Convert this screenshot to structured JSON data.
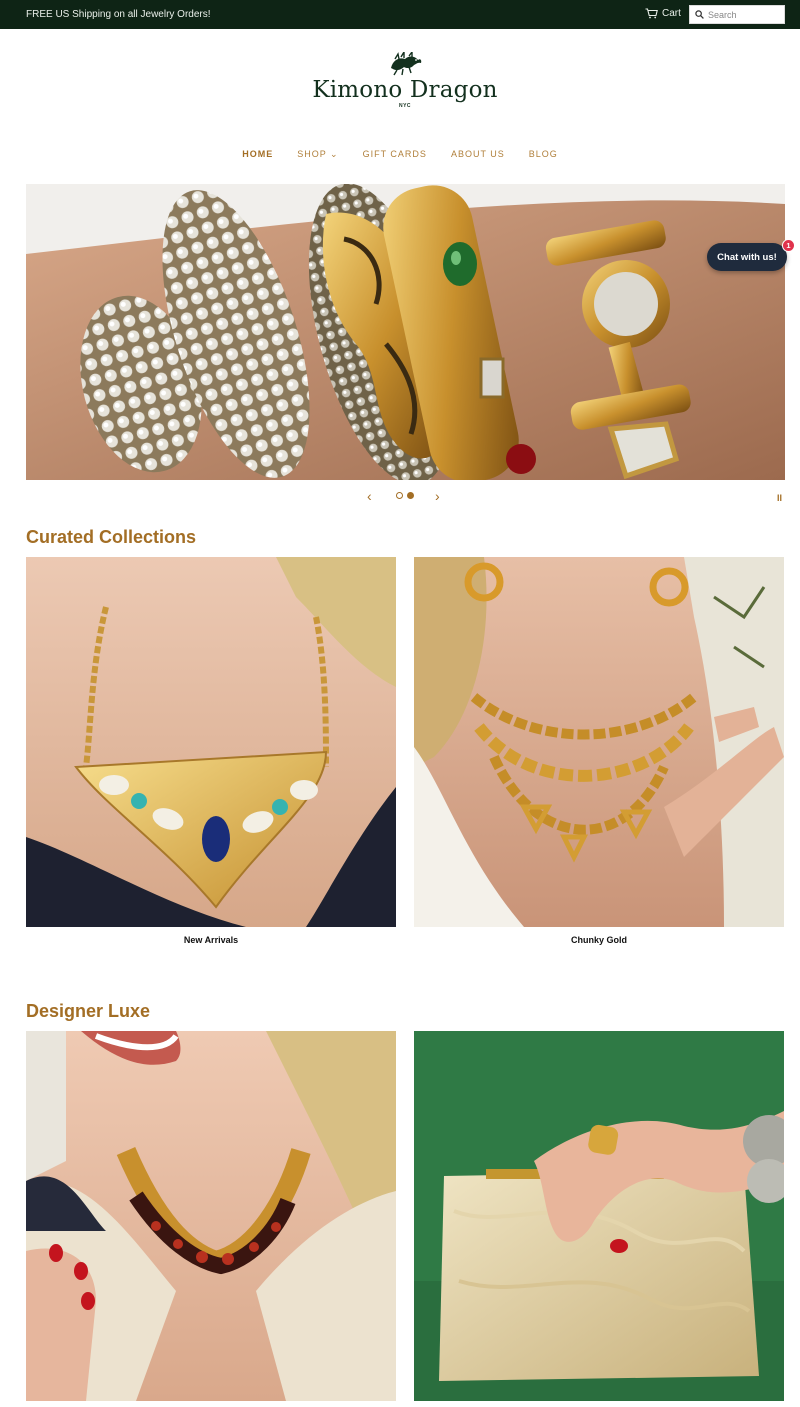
{
  "topbar": {
    "promo": "FREE US Shipping on all Jewelry Orders!",
    "cart_label": "Cart",
    "search_placeholder": "Search"
  },
  "logo": {
    "brand": "Kimono Dragon",
    "sub": "NYC"
  },
  "nav": {
    "items": [
      {
        "label": "HOME"
      },
      {
        "label": "SHOP ⌄"
      },
      {
        "label": "GIFT CARDS"
      },
      {
        "label": "ABOUT US"
      },
      {
        "label": "BLOG"
      }
    ]
  },
  "slideshow": {
    "prev": "‹",
    "next": "›",
    "pause": "II"
  },
  "chat": {
    "label": "Chat with us!",
    "badge": "1"
  },
  "curated": {
    "title": "Curated Collections",
    "tiles": [
      {
        "caption": "New Arrivals"
      },
      {
        "caption": "Chunky Gold"
      }
    ]
  },
  "designer": {
    "title": "Designer Luxe"
  },
  "colors": {
    "accent": "#a36e25",
    "topbar": "#0e2415",
    "chat": "#1f2b3d"
  }
}
